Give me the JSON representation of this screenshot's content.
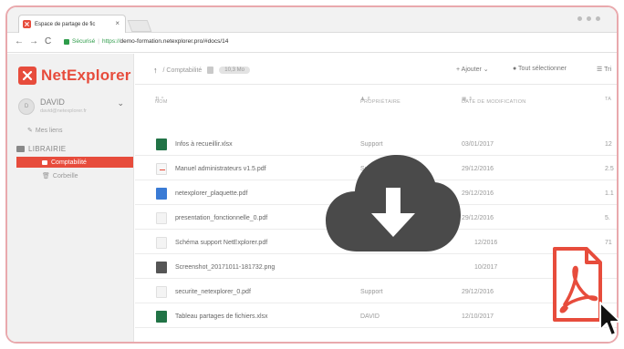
{
  "browser": {
    "tab_title": "Espace de partage de fic",
    "secure_label": "Sécurisé",
    "url_prefix": "https://",
    "url_rest": "demo-formation.netexplorer.pro/#docs/14"
  },
  "sidebar": {
    "brand": "NetExplorer",
    "user_name": "DAVID",
    "user_email": "david@netexplorer.fr",
    "links_label": "Mes liens",
    "section_label": "LIBRAIRIE",
    "items": [
      {
        "label": "Comptabilité",
        "active": true
      },
      {
        "label": "Corbeille",
        "active": false
      }
    ]
  },
  "toolbar": {
    "path": "/ Comptabilité",
    "size": "10,3 Mo",
    "add_label": "Ajouter",
    "select_all_label": "Tout sélectionner",
    "sort_label": "Tri"
  },
  "table": {
    "headers": {
      "name": "NOM",
      "owner": "PROPRIÉTAIRE",
      "date": "DATE DE MODIFICATION",
      "size": "TA"
    },
    "rows": [
      {
        "name": "Infos à recueillir.xlsx",
        "owner": "Support",
        "date": "03/01/2017",
        "size": "12",
        "icon": "xlsx-file-icon"
      },
      {
        "name": "Manuel administrateurs v1.5.pdf",
        "owner": "Support",
        "date": "29/12/2016",
        "size": "2.5",
        "icon": "pdf-file-icon"
      },
      {
        "name": "netexplorer_plaquette.pdf",
        "owner": "",
        "date": "29/12/2016",
        "size": "1.1",
        "icon": "pdf-image-file-icon"
      },
      {
        "name": "presentation_fonctionnelle_0.pdf",
        "owner": "",
        "date": "29/12/2016",
        "size": "5.",
        "icon": "pdf-file-icon"
      },
      {
        "name": "Schéma support NetExplorer.pdf",
        "owner": "",
        "date": "12/2016",
        "size": "71",
        "icon": "pdf-file-icon"
      },
      {
        "name": "Screenshot_20171011-181732.png",
        "owner": "",
        "date": "10/2017",
        "size": "",
        "icon": "png-file-icon"
      },
      {
        "name": "securite_netexplorer_0.pdf",
        "owner": "Support",
        "date": "29/12/2016",
        "size": "",
        "icon": "pdf-file-icon"
      },
      {
        "name": "Tableau partages de fichiers.xlsx",
        "owner": "DAVID",
        "date": "12/10/2017",
        "size": "",
        "icon": "xlsx-file-icon"
      }
    ]
  },
  "colors": {
    "accent": "#e74c3c",
    "frame_border": "#e9a9ad",
    "cloud": "#4a4a4a"
  }
}
